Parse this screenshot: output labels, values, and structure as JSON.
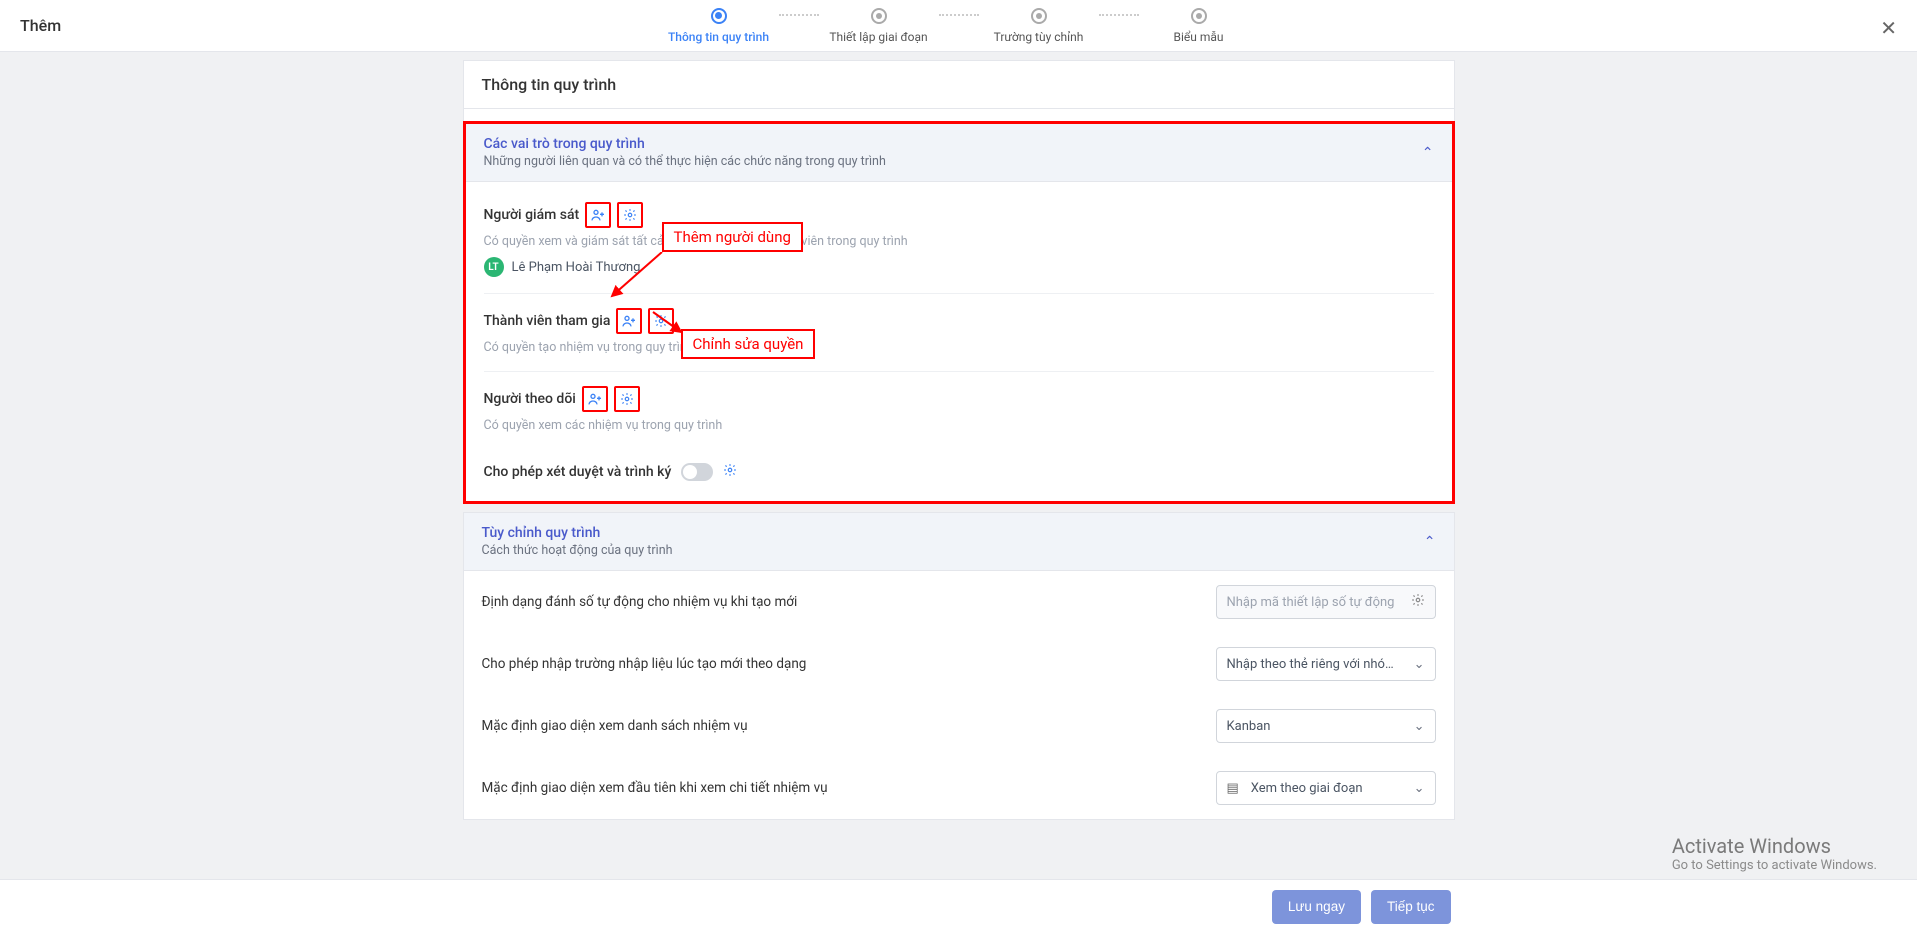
{
  "header": {
    "modal_title": "Thêm",
    "steps": [
      {
        "label": "Thông tin quy trình",
        "active": true
      },
      {
        "label": "Thiết lập giai đoạn",
        "active": false
      },
      {
        "label": "Trường tùy chỉnh",
        "active": false
      },
      {
        "label": "Biểu mẫu",
        "active": false
      }
    ]
  },
  "page_title": "Thông tin quy trình",
  "roles_panel": {
    "title": "Các vai trò trong quy trình",
    "subtitle": "Những người liên quan và có thể thực hiện các chức năng trong quy trình",
    "roles": [
      {
        "name": "Người giám sát",
        "desc": "Có quyền xem và giám sát tất cả nhiệm vụ của các thành viên trong quy trình",
        "users": [
          {
            "initials": "LT",
            "name": "Lê Phạm Hoài Thương"
          }
        ]
      },
      {
        "name": "Thành viên tham gia",
        "desc": "Có quyền tạo nhiệm vụ trong quy trình"
      },
      {
        "name": "Người theo dõi",
        "desc": "Có quyền xem các nhiệm vụ trong quy trình"
      }
    ],
    "approve_label": "Cho phép xét duyệt và trình ký"
  },
  "annotations": {
    "add_user": "Thêm người dùng",
    "edit_perm": "Chỉnh sửa quyền"
  },
  "customize_panel": {
    "title": "Tùy chỉnh quy trình",
    "subtitle": "Cách thức hoạt động của quy trình",
    "rows": {
      "auto_number": {
        "label": "Định dạng đánh số tự động cho nhiệm vụ khi tạo mới",
        "placeholder": "Nhập mã thiết lập số tự động"
      },
      "input_mode": {
        "label": "Cho phép nhập trường nhập liệu lúc tạo mới theo dạng",
        "value": "Nhập theo thẻ riêng với nhóm dữ liệ…"
      },
      "default_list": {
        "label": "Mặc định giao diện xem danh sách nhiệm vụ",
        "value": "Kanban"
      },
      "default_detail": {
        "label": "Mặc định giao diện xem đầu tiên khi xem chi tiết nhiệm vụ",
        "value": "Xem theo giai đoạn"
      }
    }
  },
  "footer": {
    "save": "Lưu ngay",
    "next": "Tiếp tục"
  },
  "watermark": {
    "line1": "Activate Windows",
    "line2": "Go to Settings to activate Windows."
  }
}
